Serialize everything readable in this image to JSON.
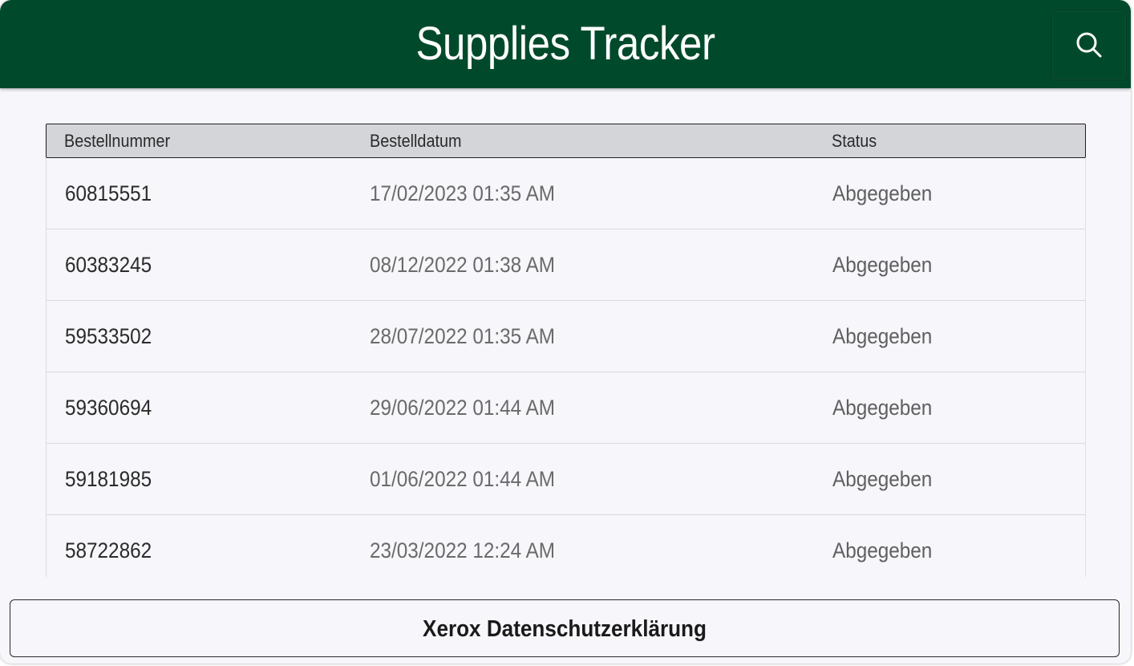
{
  "header": {
    "title": "Supplies Tracker",
    "search_icon": "search-icon",
    "background_color": "#004a2b"
  },
  "table": {
    "columns": [
      "Bestellnummer",
      "Bestelldatum",
      "Status"
    ],
    "rows": [
      {
        "order_number": "60815551",
        "order_date": "17/02/2023 01:35 AM",
        "status": "Abgegeben"
      },
      {
        "order_number": "60383245",
        "order_date": "08/12/2022 01:38 AM",
        "status": "Abgegeben"
      },
      {
        "order_number": "59533502",
        "order_date": "28/07/2022 01:35 AM",
        "status": "Abgegeben"
      },
      {
        "order_number": "59360694",
        "order_date": "29/06/2022 01:44 AM",
        "status": "Abgegeben"
      },
      {
        "order_number": "59181985",
        "order_date": "01/06/2022 01:44 AM",
        "status": "Abgegeben"
      },
      {
        "order_number": "58722862",
        "order_date": "23/03/2022 12:24 AM",
        "status": "Abgegeben"
      }
    ]
  },
  "footer": {
    "privacy_label": "Xerox Datenschutzerklärung"
  }
}
